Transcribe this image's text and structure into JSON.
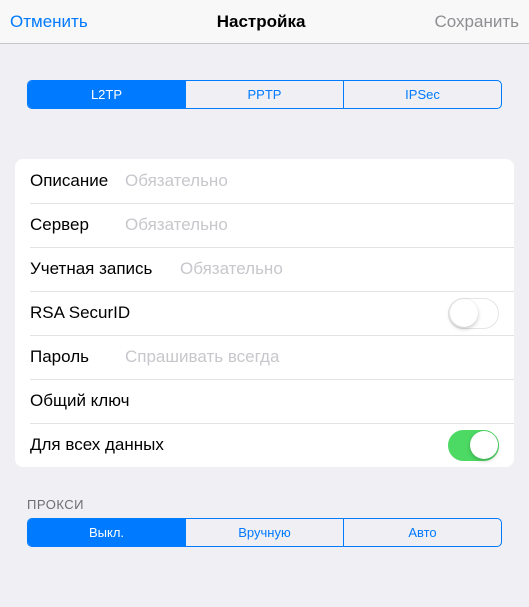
{
  "nav": {
    "cancel": "Отменить",
    "title": "Настройка",
    "save": "Сохранить"
  },
  "type_segment": {
    "items": [
      "L2TP",
      "PPTP",
      "IPSec"
    ],
    "active_index": 0
  },
  "form": {
    "description": {
      "label": "Описание",
      "value": "",
      "placeholder": "Обязательно"
    },
    "server": {
      "label": "Сервер",
      "value": "",
      "placeholder": "Обязательно"
    },
    "account": {
      "label": "Учетная запись",
      "value": "",
      "placeholder": "Обязательно"
    },
    "rsa_securid": {
      "label": "RSA SecurID",
      "on": false
    },
    "password": {
      "label": "Пароль",
      "value": "",
      "placeholder": "Спрашивать всегда"
    },
    "shared_secret": {
      "label": "Общий ключ",
      "value": "",
      "placeholder": ""
    },
    "send_all_traffic": {
      "label": "Для всех данных",
      "on": true
    }
  },
  "proxy": {
    "header": "ПРОКСИ",
    "items": [
      "Выкл.",
      "Вручную",
      "Авто"
    ],
    "active_index": 0
  }
}
